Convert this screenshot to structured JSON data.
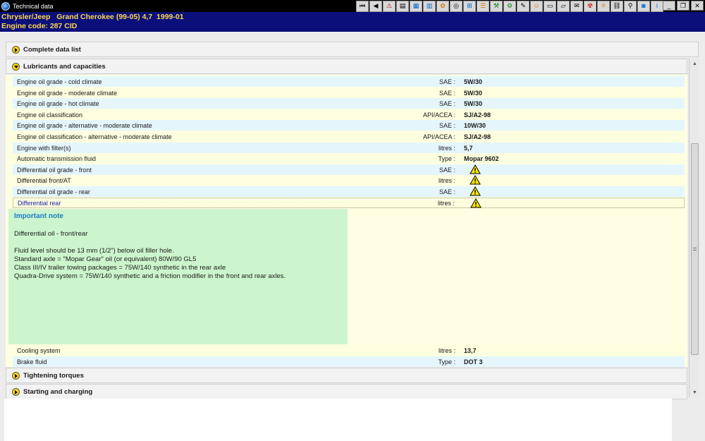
{
  "window": {
    "title": "Technical data",
    "controls": {
      "minimize": "_",
      "restore": "❐",
      "close": "✕"
    }
  },
  "toolbar": {
    "buttons": [
      {
        "icon": "first-icon",
        "glyph": "⏮"
      },
      {
        "icon": "prev-icon",
        "glyph": "◀"
      },
      {
        "icon": "warning-icon",
        "glyph": "⚠"
      },
      {
        "icon": "document-icon",
        "glyph": "▤"
      },
      {
        "icon": "chart-icon",
        "glyph": "▦"
      },
      {
        "icon": "book-icon",
        "glyph": "▥"
      },
      {
        "icon": "palette-icon",
        "glyph": "✿"
      },
      {
        "icon": "wheel-icon",
        "glyph": "◎"
      },
      {
        "icon": "measure-icon",
        "glyph": "⊞"
      },
      {
        "icon": "list-icon",
        "glyph": "☰"
      },
      {
        "icon": "tool-icon",
        "glyph": "⚒"
      },
      {
        "icon": "engine-icon",
        "glyph": "⚙"
      },
      {
        "icon": "wrench-icon",
        "glyph": "✎"
      },
      {
        "icon": "mechanic-icon",
        "glyph": "☺"
      },
      {
        "icon": "clipboard-icon",
        "glyph": "▭"
      },
      {
        "icon": "car-icon",
        "glyph": "▱"
      },
      {
        "icon": "chat-icon",
        "glyph": "✉"
      },
      {
        "icon": "hazard-icon",
        "glyph": "☢"
      },
      {
        "icon": "gears-icon",
        "glyph": "⚛"
      },
      {
        "icon": "lift-icon",
        "glyph": "⛓"
      },
      {
        "icon": "antenna-icon",
        "glyph": "⚲"
      },
      {
        "icon": "camera-icon",
        "glyph": "◙"
      },
      {
        "icon": "info-icon",
        "glyph": "i"
      }
    ]
  },
  "vehicle": {
    "line1": "Chrysler/Jeep   Grand Cherokee (99-05) 4,7  1999-01",
    "line2": "Engine code: 287 CID"
  },
  "sections": {
    "complete_list": "Complete data list",
    "lubricants": "Lubricants and capacities",
    "tightening": "Tightening torques",
    "starting": "Starting and charging"
  },
  "rows": [
    {
      "label": "Engine oil grade - cold climate",
      "unit": "SAE :",
      "value": "5W/30",
      "warn": false
    },
    {
      "label": "Engine oil grade - moderate climate",
      "unit": "SAE :",
      "value": "5W/30",
      "warn": false
    },
    {
      "label": "Engine oil grade - hot climate",
      "unit": "SAE :",
      "value": "5W/30",
      "warn": false
    },
    {
      "label": "Engine oil classification",
      "unit": "API/ACEA :",
      "value": "SJ/A2-98",
      "warn": false
    },
    {
      "label": "Engine oil grade - alternative - moderate climate",
      "unit": "SAE :",
      "value": "10W/30",
      "warn": false
    },
    {
      "label": "Engine oil classification - alternative - moderate climate",
      "unit": "API/ACEA :",
      "value": "SJ/A2-98",
      "warn": false
    },
    {
      "label": "Engine with filter(s)",
      "unit": "litres :",
      "value": "5,7",
      "warn": false
    },
    {
      "label": "Automatic transmission fluid",
      "unit": "Type :",
      "value": "Mopar 9602",
      "warn": false
    },
    {
      "label": "Differential oil grade - front",
      "unit": "SAE :",
      "value": "",
      "warn": true
    },
    {
      "label": "Differential front/AT",
      "unit": "litres :",
      "value": "",
      "warn": true
    },
    {
      "label": "Differential oil grade - rear",
      "unit": "SAE :",
      "value": "",
      "warn": true
    },
    {
      "label": "Differential rear",
      "unit": "litres :",
      "value": "",
      "warn": true
    }
  ],
  "note": {
    "title": "Important note",
    "lines": [
      "Differential oil - front/rear",
      "",
      "Fluid level should be 13 mm (1/2\") below oil filler hole.",
      "Standard axle = \"Mopar Gear\" oil (or equivalent) 80W/90 GL5",
      "Class III/IV trailer towing packages = 75W/140 synthetic in the rear axle",
      "Quadra-Drive system = 75W/140 synthetic and a friction modifier in the front and rear axles."
    ]
  },
  "rows_after": [
    {
      "label": "Cooling system",
      "unit": "litres :",
      "value": "13,7"
    },
    {
      "label": "Brake fluid",
      "unit": "Type :",
      "value": "DOT 3"
    }
  ],
  "scrollbar": {
    "up": "▲",
    "down": "▼"
  }
}
